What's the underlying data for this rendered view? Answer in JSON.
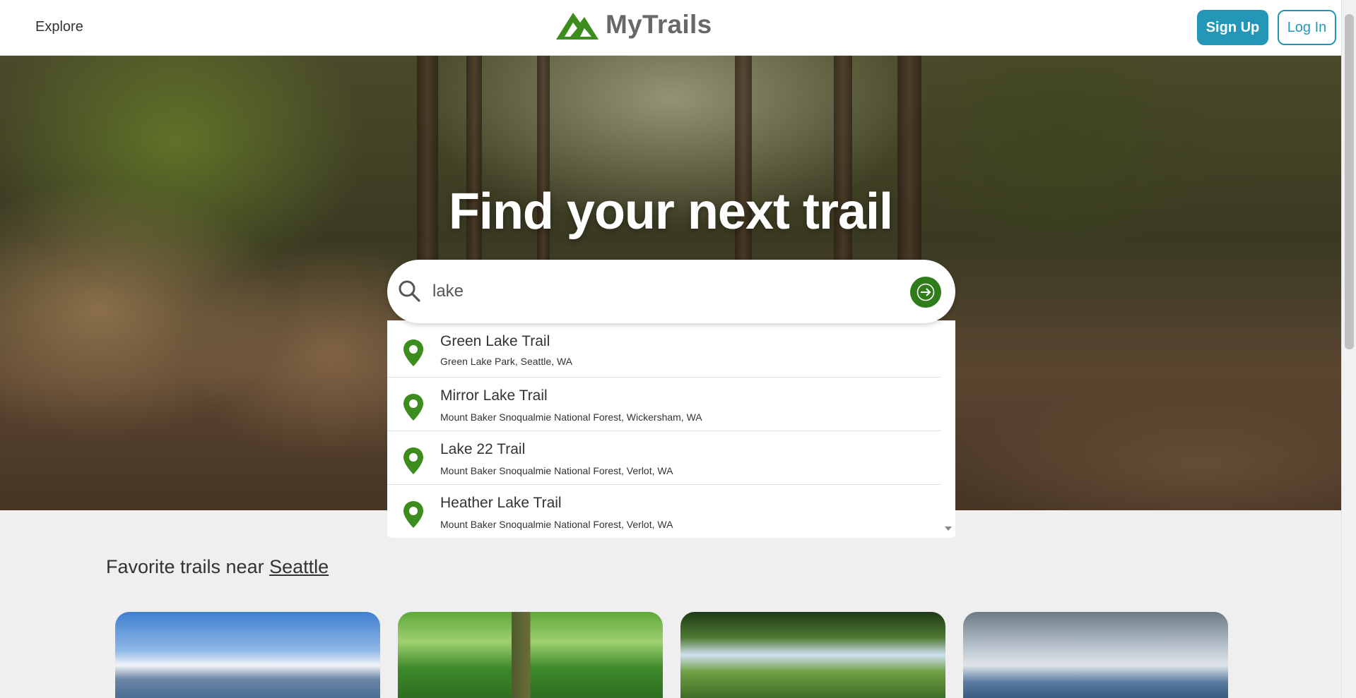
{
  "header": {
    "explore_label": "Explore",
    "logo_text": "MyTrails",
    "signup_label": "Sign Up",
    "login_label": "Log In"
  },
  "hero": {
    "title": "Find your next trail"
  },
  "search": {
    "value": "lake",
    "icon": "search-icon",
    "submit_icon": "arrow-right-icon"
  },
  "suggestions": [
    {
      "title": "Green Lake Trail",
      "location": "Green Lake Park, Seattle, WA"
    },
    {
      "title": "Mirror Lake Trail",
      "location": "Mount Baker Snoqualmie National Forest, Wickersham, WA"
    },
    {
      "title": "Lake 22 Trail",
      "location": "Mount Baker Snoqualmie National Forest, Verlot, WA"
    },
    {
      "title": "Heather Lake Trail",
      "location": "Mount Baker Snoqualmie National Forest, Verlot, WA"
    }
  ],
  "favorites": {
    "prefix": "Favorite trails near ",
    "city": "Seattle"
  },
  "colors": {
    "brand_green": "#2e7d1a",
    "accent_blue": "#2496b8",
    "page_bg": "#efefef"
  }
}
